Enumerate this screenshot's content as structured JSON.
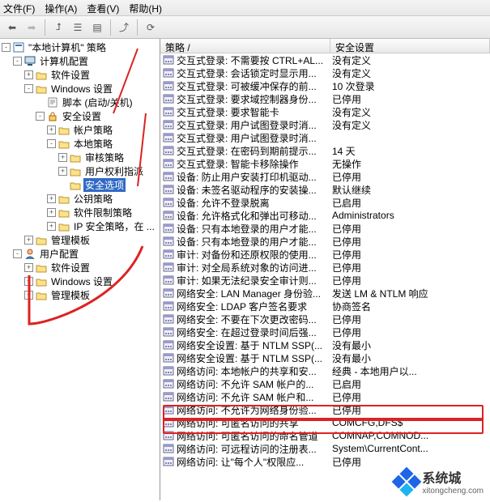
{
  "menu": {
    "file": "文件(F)",
    "action": "操作(A)",
    "view": "查看(V)",
    "help": "帮助(H)"
  },
  "toolbar_icons": [
    "back-icon",
    "forward-icon",
    "up-icon",
    "show-hide-tree-icon",
    "properties-icon",
    "export-icon",
    "refresh-icon",
    "help-icon"
  ],
  "tree": [
    {
      "d": 0,
      "tw": "-",
      "ic": "policy",
      "t": "\"本地计算机\" 策略"
    },
    {
      "d": 1,
      "tw": "-",
      "ic": "computer",
      "t": "计算机配置"
    },
    {
      "d": 2,
      "tw": "+",
      "ic": "folder",
      "t": "软件设置"
    },
    {
      "d": 2,
      "tw": "-",
      "ic": "folder",
      "t": "Windows 设置"
    },
    {
      "d": 3,
      "tw": "",
      "ic": "script",
      "t": "脚本 (启动/关机)"
    },
    {
      "d": 3,
      "tw": "-",
      "ic": "lock",
      "t": "安全设置"
    },
    {
      "d": 4,
      "tw": "+",
      "ic": "folder",
      "t": "帐户策略"
    },
    {
      "d": 4,
      "tw": "-",
      "ic": "folder",
      "t": "本地策略"
    },
    {
      "d": 5,
      "tw": "+",
      "ic": "folder",
      "t": "审核策略"
    },
    {
      "d": 5,
      "tw": "+",
      "ic": "folder",
      "t": "用户权利指派"
    },
    {
      "d": 5,
      "tw": "",
      "ic": "folder",
      "t": "安全选项",
      "sel": true
    },
    {
      "d": 4,
      "tw": "+",
      "ic": "folder",
      "t": "公钥策略"
    },
    {
      "d": 4,
      "tw": "+",
      "ic": "folder",
      "t": "软件限制策略"
    },
    {
      "d": 4,
      "tw": "+",
      "ic": "folder",
      "t": "IP 安全策略，在 ..."
    },
    {
      "d": 2,
      "tw": "+",
      "ic": "folder",
      "t": "管理模板"
    },
    {
      "d": 1,
      "tw": "-",
      "ic": "user",
      "t": "用户配置"
    },
    {
      "d": 2,
      "tw": "+",
      "ic": "folder",
      "t": "软件设置"
    },
    {
      "d": 2,
      "tw": "+",
      "ic": "folder",
      "t": "Windows 设置"
    },
    {
      "d": 2,
      "tw": "+",
      "ic": "folder",
      "t": "管理模板"
    }
  ],
  "columns": {
    "policy": "策略  /",
    "setting": "安全设置"
  },
  "rows": [
    {
      "p": "交互式登录: 不需要按 CTRL+AL...",
      "s": "没有定义"
    },
    {
      "p": "交互式登录: 会话锁定时显示用...",
      "s": "没有定义"
    },
    {
      "p": "交互式登录: 可被缓冲保存的前...",
      "s": "10 次登录"
    },
    {
      "p": "交互式登录: 要求域控制器身份...",
      "s": "已停用"
    },
    {
      "p": "交互式登录: 要求智能卡",
      "s": "没有定义"
    },
    {
      "p": "交互式登录: 用户试图登录时消...",
      "s": "没有定义"
    },
    {
      "p": "交互式登录: 用户试图登录时消...",
      "s": ""
    },
    {
      "p": "交互式登录: 在密码到期前提示...",
      "s": "14 天"
    },
    {
      "p": "交互式登录: 智能卡移除操作",
      "s": "无操作"
    },
    {
      "p": "设备: 防止用户安装打印机驱动...",
      "s": "已停用"
    },
    {
      "p": "设备: 未签名驱动程序的安装操...",
      "s": "默认继续"
    },
    {
      "p": "设备: 允许不登录脱离",
      "s": "已启用"
    },
    {
      "p": "设备: 允许格式化和弹出可移动...",
      "s": "Administrators"
    },
    {
      "p": "设备: 只有本地登录的用户才能...",
      "s": "已停用"
    },
    {
      "p": "设备: 只有本地登录的用户才能...",
      "s": "已停用"
    },
    {
      "p": "审计: 对备份和还原权限的使用...",
      "s": "已停用"
    },
    {
      "p": "审计: 对全局系统对象的访问进...",
      "s": "已停用"
    },
    {
      "p": "审计: 如果无法纪录安全审计则...",
      "s": "已停用"
    },
    {
      "p": "网络安全: LAN Manager 身份验...",
      "s": "发送 LM & NTLM 响应"
    },
    {
      "p": "网络安全: LDAP 客户签名要求",
      "s": "协商签名"
    },
    {
      "p": "网络安全: 不要在下次更改密码...",
      "s": "已停用"
    },
    {
      "p": "网络安全: 在超过登录时间后强...",
      "s": "已停用"
    },
    {
      "p": "网络安全设置: 基于 NTLM SSP(...",
      "s": "没有最小"
    },
    {
      "p": "网络安全设置: 基于 NTLM SSP(...",
      "s": "没有最小"
    },
    {
      "p": "网络访问: 本地帐户的共享和安...",
      "s": "经典 - 本地用户以..."
    },
    {
      "p": "网络访问: 不允许 SAM 帐户的...",
      "s": "已启用"
    },
    {
      "p": "网络访问: 不允许 SAM 帐户和...",
      "s": "已停用"
    },
    {
      "p": "网络访问: 不允许为网络身份验...",
      "s": "已停用"
    },
    {
      "p": "网络访问: 可匿名访问的共享",
      "s": "COMCFG,DFS$"
    },
    {
      "p": "网络访问: 可匿名访问的命名管道",
      "s": "COMNAP,COMNOD..."
    },
    {
      "p": "网络访问: 可远程访问的注册表...",
      "s": "System\\CurrentCont..."
    },
    {
      "p": "网络访问: 让\"每个人\"权限应...",
      "s": "已停用"
    }
  ],
  "watermark": {
    "brand": "系统城",
    "url": "xitongcheng.com"
  }
}
